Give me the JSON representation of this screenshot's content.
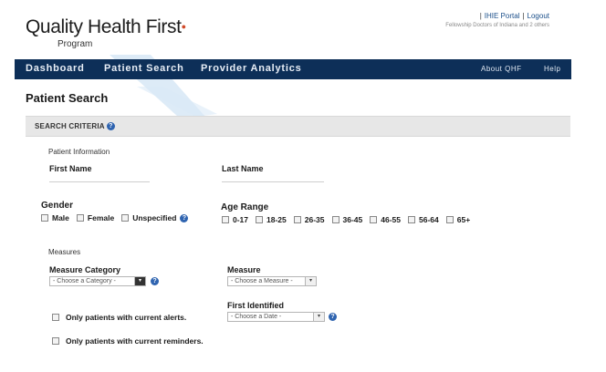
{
  "header": {
    "logo_text": "Quality Health First",
    "logo_subtitle": "Program",
    "util_links": [
      "IHIE Portal",
      "Logout"
    ],
    "util_subtext": "Fellowship Doctors of Indiana and 2 others"
  },
  "nav": {
    "items": [
      "Dashboard",
      "Patient Search",
      "Provider Analytics"
    ],
    "right": [
      "About QHF",
      "Help"
    ]
  },
  "page": {
    "title": "Patient Search",
    "criteria_label": "SEARCH CRITERIA"
  },
  "patient_info": {
    "section": "Patient Information",
    "first_name_label": "First Name",
    "first_name_value": "",
    "last_name_label": "Last Name",
    "last_name_value": ""
  },
  "gender": {
    "label": "Gender",
    "options": [
      "Male",
      "Female",
      "Unspecified"
    ]
  },
  "age_range": {
    "label": "Age Range",
    "options": [
      "0-17",
      "18-25",
      "26-35",
      "36-45",
      "46-55",
      "56-64",
      "65+"
    ]
  },
  "measures": {
    "section": "Measures",
    "category_label": "Measure Category",
    "category_selected": "- Choose a Category -",
    "measure_label": "Measure",
    "measure_selected": "- Choose a Measure -",
    "first_identified_label": "First Identified",
    "first_identified_selected": "- Choose a Date -",
    "alerts_label": "Only patients with current alerts.",
    "reminders_label": "Only patients with current reminders."
  },
  "colors": {
    "nav_bg": "#0d2f58",
    "criteria_bg": "#e7e7e7",
    "link": "#1b4f8a",
    "help_icon": "#2f64b0"
  }
}
